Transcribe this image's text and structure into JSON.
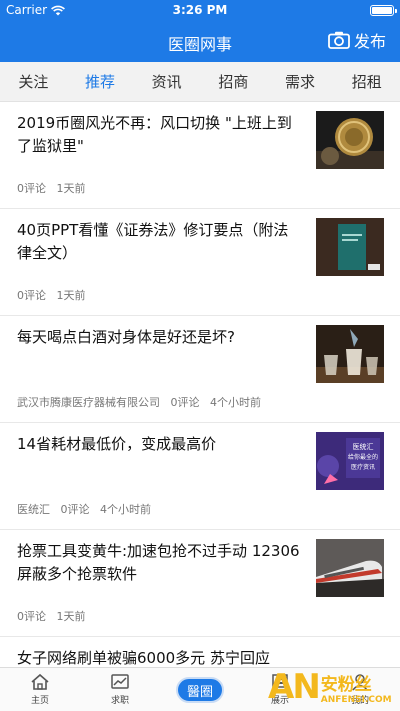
{
  "status_bar": {
    "carrier": "Carrier",
    "time": "3:26 PM"
  },
  "nav": {
    "title": "医圈网事",
    "publish_label": "发布"
  },
  "tabs": [
    {
      "label": "关注"
    },
    {
      "label": "推荐"
    },
    {
      "label": "资讯"
    },
    {
      "label": "招商"
    },
    {
      "label": "需求"
    },
    {
      "label": "招租"
    }
  ],
  "active_tab": "推荐",
  "articles": [
    {
      "title": "2019币圈风光不再：风口切换 \"上班上到了监狱里\"",
      "source": "",
      "comments": "0评论",
      "time": "1天前"
    },
    {
      "title": "40页PPT看懂《证券法》修订要点（附法律全文）",
      "source": "",
      "comments": "0评论",
      "time": "1天前"
    },
    {
      "title": "每天喝点白酒对身体是好还是坏?",
      "source": "武汉市腾康医疗器械有限公司",
      "comments": "0评论",
      "time": "4个小时前"
    },
    {
      "title": "14省耗材最低价，变成最高价",
      "source": "医统汇",
      "comments": "0评论",
      "time": "4个小时前"
    },
    {
      "title": "抢票工具变黄牛:加速包抢不过手动 12306屏蔽多个抢票软件",
      "source": "",
      "comments": "0评论",
      "time": "1天前"
    }
  ],
  "partial_article": {
    "title": "女子网络刷单被骗6000多元 苏宁回应"
  },
  "thumb_texts": {
    "book_cover": "医统汇\n给你最全的\n医疗资讯"
  },
  "bottom_tabs": [
    {
      "label": "主页",
      "icon": "home-icon"
    },
    {
      "label": "求职",
      "icon": "job-icon"
    },
    {
      "label": "",
      "icon": "center-logo",
      "logo_text": "醫圈"
    },
    {
      "label": "展示",
      "icon": "display-icon"
    },
    {
      "label": "我的",
      "icon": "profile-icon"
    }
  ],
  "watermark": {
    "letters": "AN",
    "cn": "安粉丝",
    "en": "ANFENSI.COM"
  },
  "colors": {
    "brand": "#1e7ae6",
    "tab_bg": "#f2f2f2",
    "watermark": "#f3b81d"
  }
}
